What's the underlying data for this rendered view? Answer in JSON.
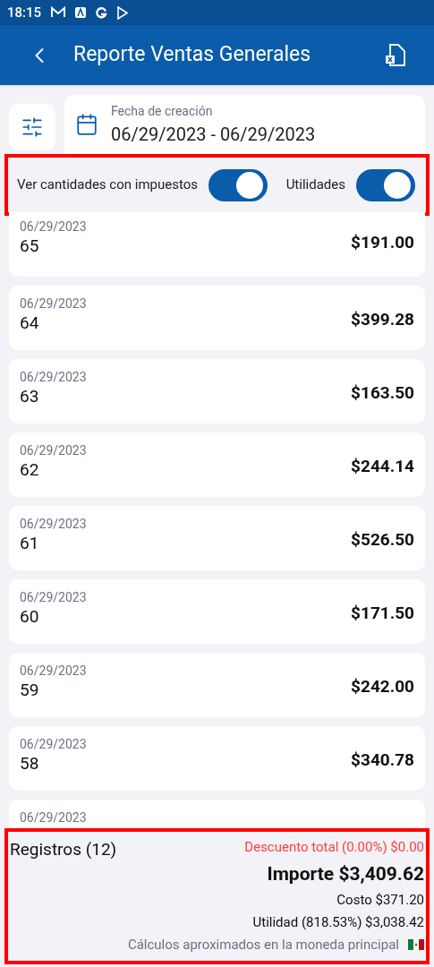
{
  "status_bar": {
    "time": "18:15"
  },
  "app_bar": {
    "title": "Reporte Ventas Generales"
  },
  "date_filter": {
    "label": "Fecha de creación",
    "value": "06/29/2023 - 06/29/2023"
  },
  "toggles": [
    {
      "label": "Ver cantidades con impuestos",
      "on": true
    },
    {
      "label": "Utilidades",
      "on": true
    }
  ],
  "sales": [
    {
      "date": "06/29/2023",
      "number": "65",
      "amount": "$191.00"
    },
    {
      "date": "06/29/2023",
      "number": "64",
      "amount": "$399.28"
    },
    {
      "date": "06/29/2023",
      "number": "63",
      "amount": "$163.50"
    },
    {
      "date": "06/29/2023",
      "number": "62",
      "amount": "$244.14"
    },
    {
      "date": "06/29/2023",
      "number": "61",
      "amount": "$526.50"
    },
    {
      "date": "06/29/2023",
      "number": "60",
      "amount": "$171.50"
    },
    {
      "date": "06/29/2023",
      "number": "59",
      "amount": "$242.00"
    },
    {
      "date": "06/29/2023",
      "number": "58",
      "amount": "$340.78"
    },
    {
      "date": "06/29/2023"
    }
  ],
  "summary": {
    "records": "Registros (12)",
    "discount": "Descuento total (0.00%) $0.00",
    "total": "Importe $3,409.62",
    "cost": "Costo $371.20",
    "profit": "Utilidad (818.53%) $3,038.42",
    "note": "Cálculos aproximados en la moneda principal"
  }
}
